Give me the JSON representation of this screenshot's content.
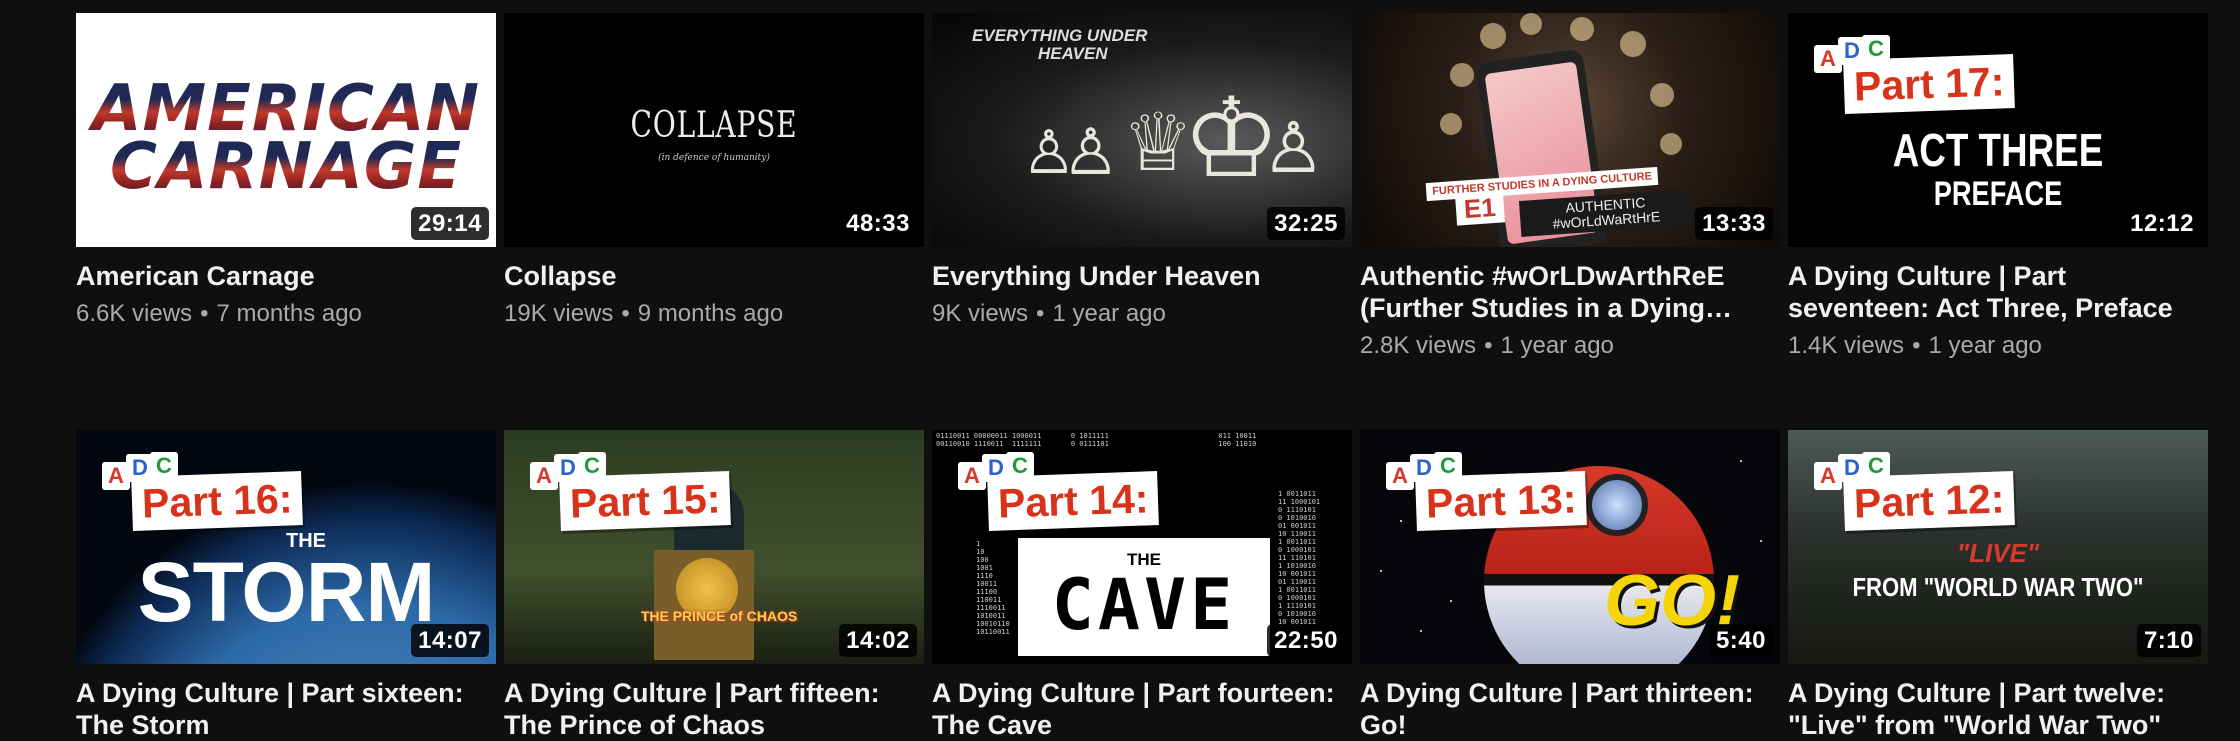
{
  "videos": [
    {
      "title": "American Carnage",
      "views": "6.6K views",
      "age": "7 months ago",
      "duration": "29:14",
      "thumb_text": [
        "AMERICAN",
        "CARNAGE"
      ]
    },
    {
      "title": "Collapse",
      "views": "19K views",
      "age": "9 months ago",
      "duration": "48:33",
      "thumb_text": [
        "COLLAPSE",
        "(in defence of humanity)"
      ]
    },
    {
      "title": "Everything Under Heaven",
      "views": "9K views",
      "age": "1 year ago",
      "duration": "32:25",
      "thumb_text": [
        "EVERYTHING UNDER",
        "HEAVEN"
      ]
    },
    {
      "title": "Authentic #wOrLDwArthReE (Further Studies in a Dying Culture)",
      "views": "2.8K views",
      "age": "1 year ago",
      "duration": "13:33",
      "thumb_text": [
        "FURTHER STUDIES IN A DYING CULTURE",
        "E1",
        "AUTHENTIC",
        "#wOrLdWaRtHrE"
      ]
    },
    {
      "title": "A Dying Culture | Part seventeen: Act Three, Preface",
      "views": "1.4K views",
      "age": "1 year ago",
      "duration": "12:12",
      "thumb_text": [
        "Part 17:",
        "ACT THREE",
        "PREFACE"
      ]
    },
    {
      "title": "A Dying Culture | Part sixteen: The Storm",
      "duration": "14:07",
      "thumb_text": [
        "Part 16:",
        "THE",
        "STORM"
      ]
    },
    {
      "title": "A Dying Culture | Part fifteen: The Prince of Chaos",
      "duration": "14:02",
      "thumb_text": [
        "Part 15:",
        "THE PRINCE of CHAOS"
      ]
    },
    {
      "title": "A Dying Culture | Part fourteen: The Cave",
      "duration": "22:50",
      "thumb_text": [
        "Part 14:",
        "THE",
        "CAVE"
      ]
    },
    {
      "title": "A Dying Culture | Part thirteen: Go!",
      "duration": "5:40",
      "thumb_text": [
        "Part 13:",
        "GO!"
      ]
    },
    {
      "title": "A Dying Culture | Part twelve: \"Live\" from \"World War Two\"",
      "duration": "7:10",
      "thumb_text": [
        "Part 12:",
        "\"LIVE\"",
        "FROM \"WORLD WAR TWO\""
      ]
    }
  ],
  "adc_logo": [
    "A",
    "D",
    "C"
  ],
  "colors": {
    "background": "#0f0f0f",
    "title": "#f1f1f1",
    "meta": "#aaaaaa",
    "part_label": "#d8321b"
  }
}
